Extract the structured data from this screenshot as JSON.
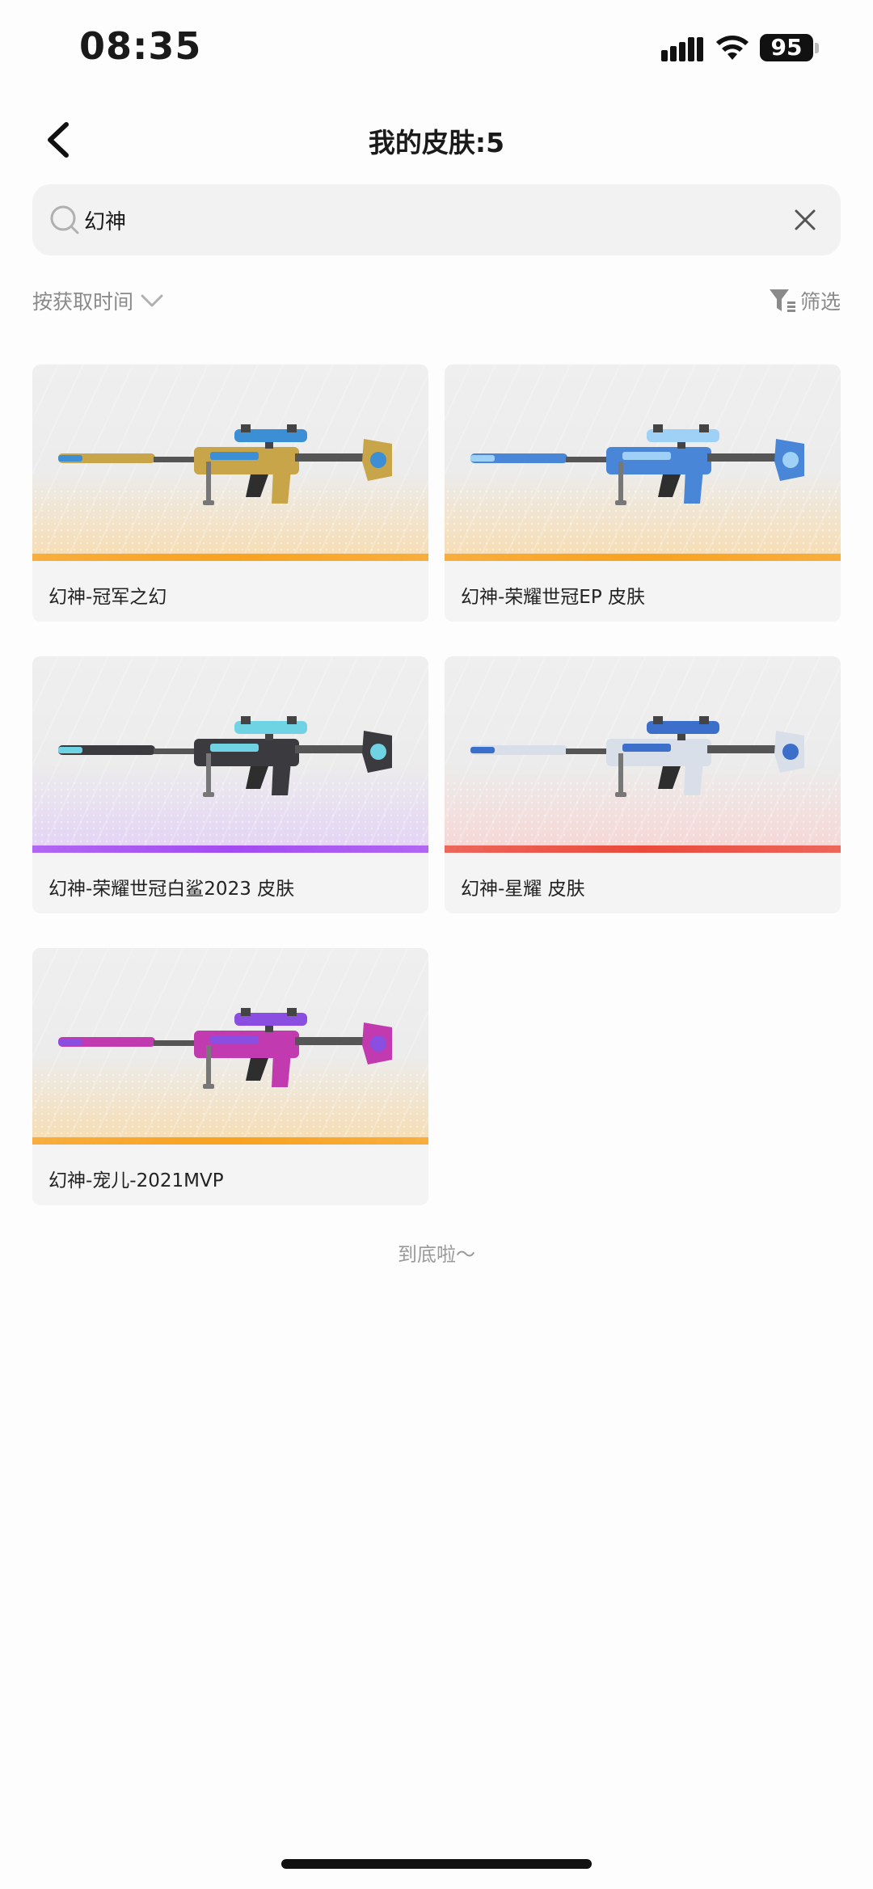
{
  "status_bar": {
    "time": "08:35",
    "battery": "95"
  },
  "header": {
    "title": "我的皮肤:5"
  },
  "search": {
    "value": "幻神",
    "placeholder": ""
  },
  "sort": {
    "label": "按获取时间"
  },
  "filter": {
    "label": "筛选"
  },
  "skins": [
    {
      "name": "幻神-冠军之幻",
      "tint": "#f7dcb0",
      "bar": "#f8a21f",
      "gun_main": "#c9a54a",
      "gun_accent": "#3c8fd4"
    },
    {
      "name": "幻神-荣耀世冠EP 皮肤",
      "tint": "#f7dcb0",
      "bar": "#f8a21f",
      "gun_main": "#4a86d8",
      "gun_accent": "#9fd0f5"
    },
    {
      "name": "幻神-荣耀世冠白鲨2023 皮肤",
      "tint": "#e3d2f5",
      "bar": "#a34bf2",
      "gun_main": "#3a3a3f",
      "gun_accent": "#6fd3e3"
    },
    {
      "name": "幻神-星耀 皮肤",
      "tint": "#f6d6d4",
      "bar": "#ea4a3c",
      "gun_main": "#d9dfe8",
      "gun_accent": "#3b6fc9"
    },
    {
      "name": "幻神-宠儿-2021MVP",
      "tint": "#f7dcb0",
      "bar": "#f8a21f",
      "gun_main": "#c23ab0",
      "gun_accent": "#8a4fe0"
    }
  ],
  "footer": {
    "end_text": "到底啦～"
  }
}
